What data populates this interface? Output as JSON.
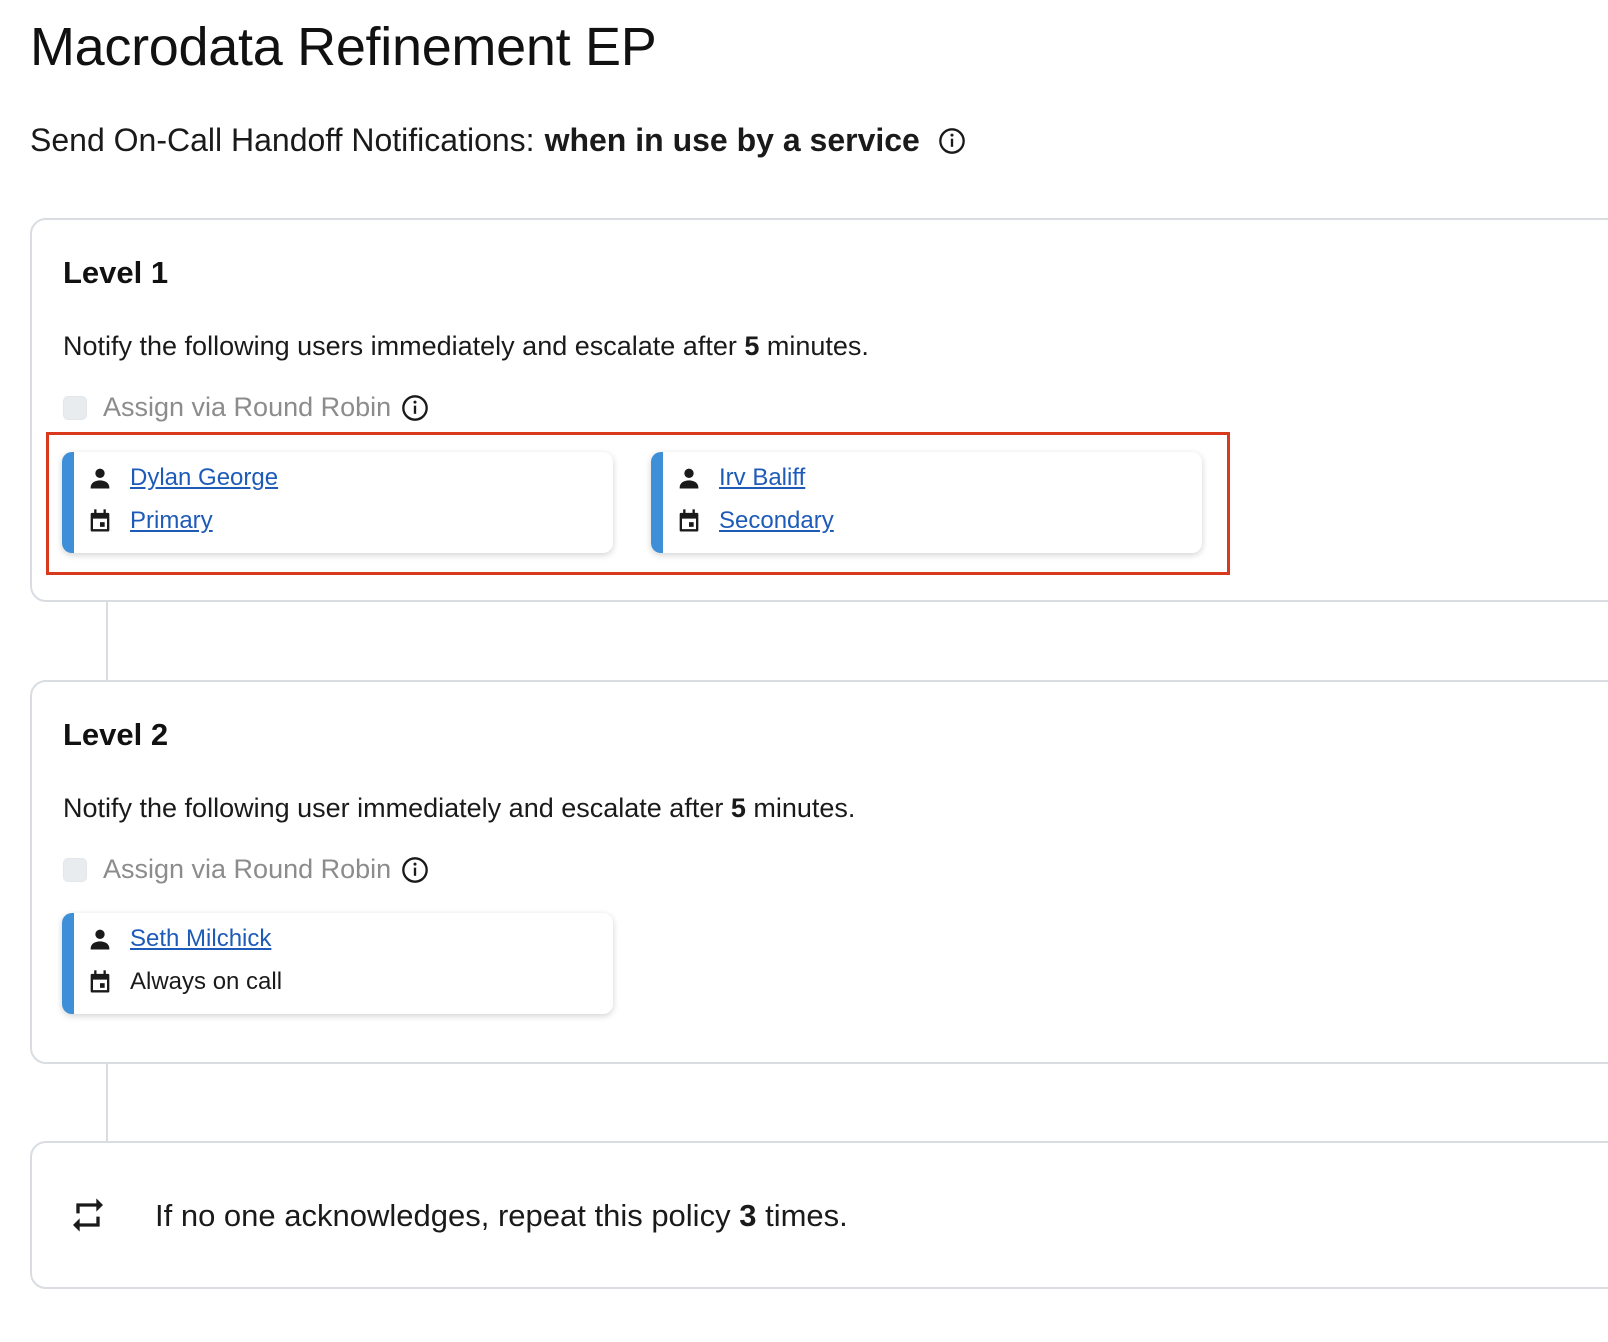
{
  "page_title": "Macrodata Refinement EP",
  "handoff": {
    "label": "Send On-Call Handoff Notifications:",
    "value": "when in use by a service",
    "info_icon": "info-icon"
  },
  "levels": [
    {
      "title": "Level 1",
      "desc_prefix": "Notify the following users immediately and escalate after",
      "minutes": "5",
      "desc_suffix": "minutes.",
      "round_robin_label": "Assign via Round Robin",
      "round_robin_checked": false,
      "targets": [
        {
          "user": "Dylan George",
          "schedule": "Primary",
          "user_icon": "person-icon",
          "schedule_icon": "calendar-icon"
        },
        {
          "user": "Irv Baliff",
          "schedule": "Secondary",
          "user_icon": "person-icon",
          "schedule_icon": "calendar-icon"
        }
      ]
    },
    {
      "title": "Level 2",
      "desc_prefix": "Notify the following user immediately and escalate after",
      "minutes": "5",
      "desc_suffix": "minutes.",
      "round_robin_label": "Assign via Round Robin",
      "round_robin_checked": false,
      "targets": [
        {
          "user": "Seth Milchick",
          "schedule": "Always on call",
          "user_icon": "person-icon",
          "schedule_icon": "calendar-icon"
        }
      ]
    }
  ],
  "repeat": {
    "prefix": "If no one acknowledges, repeat this policy",
    "count": "3",
    "suffix": "times.",
    "icon": "repeat-icon"
  },
  "colors": {
    "accent_bar": "#3d8fd8",
    "link": "#1e5bb8",
    "highlight_border": "#d93a1e",
    "card_border": "#d9dde2"
  }
}
